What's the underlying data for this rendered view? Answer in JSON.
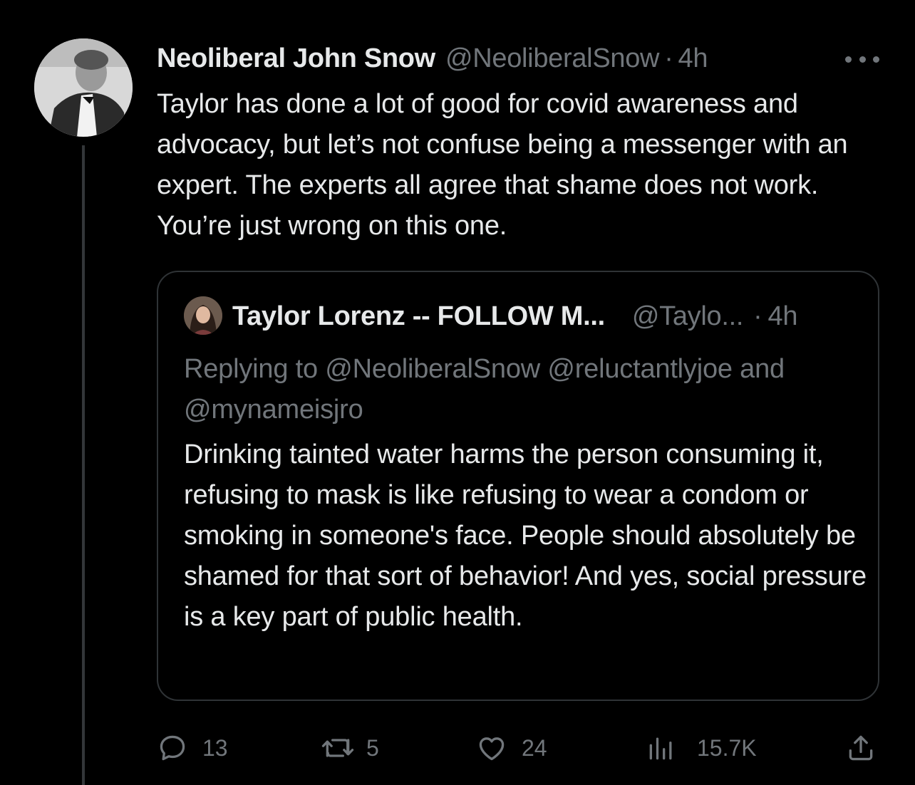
{
  "tweet": {
    "author_name": "Neoliberal John Snow",
    "author_handle": "@NeoliberalSnow",
    "separator": "·",
    "time": "4h",
    "avatar_icon": "portrait-photo-avatar",
    "more_icon": "more-horizontal-icon",
    "text": "Taylor has done a lot of good for covid awareness and advocacy, but let’s not confuse being a messenger with an expert. The experts all agree that shame does not work. You’re just wrong on this one."
  },
  "quoted_tweet": {
    "author_name": "Taylor Lorenz -- FOLLOW M...",
    "author_handle": "@Taylo...",
    "separator": "·",
    "time": "4h",
    "avatar_icon": "portrait-photo-avatar",
    "replying_to": "Replying to @NeoliberalSnow @reluctantlyjoe and @mynameisjro",
    "text": "Drinking tainted water harms the person consuming it, refusing to mask is like refusing to wear a condom or smoking in someone's face. People should absolutely be shamed for that sort of behavior! And yes, social pressure is a key part of public health."
  },
  "actions": {
    "replies": "13",
    "reposts": "5",
    "likes": "24",
    "views": "15.7K",
    "icons": [
      "reply-icon",
      "repost-icon",
      "like-icon",
      "views-icon",
      "share-icon"
    ]
  },
  "colors": {
    "background": "#000000",
    "primary_text": "#e7e9ea",
    "secondary_text": "#71767b",
    "border": "#2f3336"
  }
}
